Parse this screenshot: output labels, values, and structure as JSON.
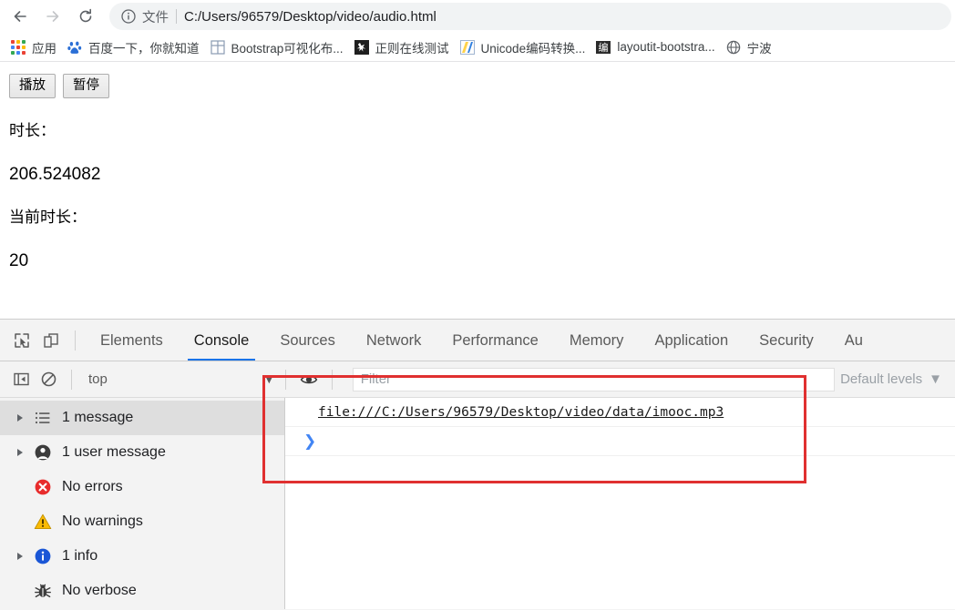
{
  "browser": {
    "nav": {
      "back_icon": "arrow-left-icon",
      "forward_icon": "arrow-right-icon",
      "reload_icon": "reload-icon"
    },
    "omnibox": {
      "info_icon": "info-circle-icon",
      "scheme_label": "文件",
      "url": "C:/Users/96579/Desktop/video/audio.html"
    },
    "bookmarks": [
      {
        "label": "应用",
        "icon": "apps-grid-icon"
      },
      {
        "label": "百度一下，你就知道",
        "icon": "baidu-paw-icon"
      },
      {
        "label": "Bootstrap可视化布...",
        "icon": "grid-layout-icon"
      },
      {
        "label": "正则在线测试",
        "icon": "regex-dark-icon"
      },
      {
        "label": "Unicode编码转换...",
        "icon": "unicode-icon"
      },
      {
        "label": "layoutit-bootstra...",
        "icon": "bian-icon"
      },
      {
        "label": "宁波",
        "icon": "globe-icon"
      }
    ]
  },
  "page": {
    "buttons": [
      {
        "label": "播放",
        "name": "play-button"
      },
      {
        "label": "暂停",
        "name": "pause-button"
      }
    ],
    "duration_label": "时长：",
    "duration_value": "206.524082",
    "current_label": "当前时长：",
    "current_value": "20"
  },
  "devtools": {
    "toolbar_icons": {
      "inspect": "inspect-element-icon",
      "device": "device-toolbar-icon"
    },
    "tabs": [
      {
        "label": "Elements",
        "active": false
      },
      {
        "label": "Console",
        "active": true
      },
      {
        "label": "Sources",
        "active": false
      },
      {
        "label": "Network",
        "active": false
      },
      {
        "label": "Performance",
        "active": false
      },
      {
        "label": "Memory",
        "active": false
      },
      {
        "label": "Application",
        "active": false
      },
      {
        "label": "Security",
        "active": false
      },
      {
        "label": "Au",
        "active": false
      }
    ],
    "console_toolbar": {
      "sidebar_toggle_icon": "show-console-sidebar-icon",
      "clear_icon": "clear-console-icon",
      "context": "top",
      "context_caret": "▼",
      "eye_icon": "live-expression-eye-icon",
      "filter_placeholder": "Filter",
      "levels_label": "Default levels",
      "levels_caret": "▼"
    },
    "sidebar": [
      {
        "label": "1 message",
        "icon": "list-icon",
        "expandable": true,
        "selected": true
      },
      {
        "label": "1 user message",
        "icon": "user-icon",
        "expandable": true,
        "selected": false
      },
      {
        "label": "No errors",
        "icon": "error-icon",
        "expandable": false,
        "selected": false
      },
      {
        "label": "No warnings",
        "icon": "warning-icon",
        "expandable": false,
        "selected": false
      },
      {
        "label": "1 info",
        "icon": "info-icon",
        "expandable": true,
        "selected": false
      },
      {
        "label": "No verbose",
        "icon": "bug-icon",
        "expandable": false,
        "selected": false
      }
    ],
    "messages": [
      {
        "text": "file:///C:/Users/96579/Desktop/video/data/imooc.mp3",
        "type": "link"
      }
    ],
    "prompt_caret": "❯"
  },
  "annotation": {
    "color": "#e03030",
    "shape": "rectangle"
  }
}
